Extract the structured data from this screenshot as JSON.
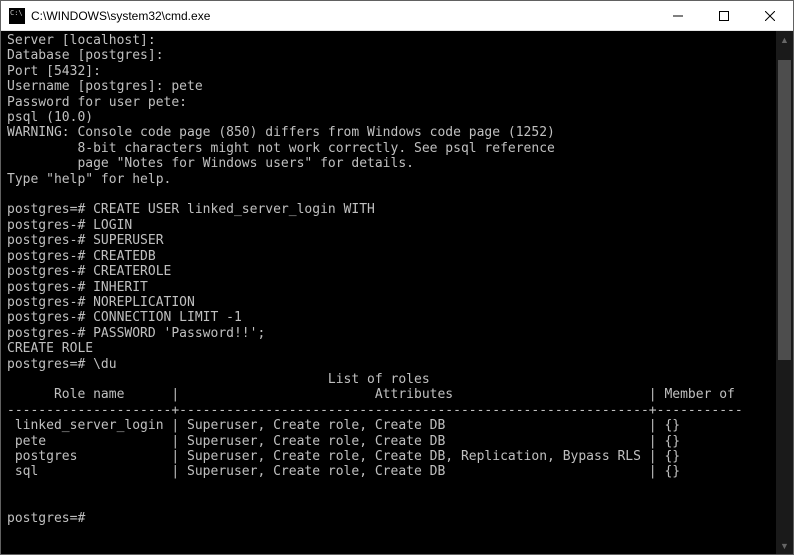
{
  "window": {
    "title": "C:\\WINDOWS\\system32\\cmd.exe"
  },
  "terminal": {
    "lines": [
      "Server [localhost]:",
      "Database [postgres]:",
      "Port [5432]:",
      "Username [postgres]: pete",
      "Password for user pete:",
      "psql (10.0)",
      "WARNING: Console code page (850) differs from Windows code page (1252)",
      "         8-bit characters might not work correctly. See psql reference",
      "         page \"Notes for Windows users\" for details.",
      "Type \"help\" for help.",
      "",
      "postgres=# CREATE USER linked_server_login WITH",
      "postgres-# LOGIN",
      "postgres-# SUPERUSER",
      "postgres-# CREATEDB",
      "postgres-# CREATEROLE",
      "postgres-# INHERIT",
      "postgres-# NOREPLICATION",
      "postgres-# CONNECTION LIMIT -1",
      "postgres-# PASSWORD 'Password!!';",
      "CREATE ROLE",
      "postgres=# \\du",
      "                                         List of roles",
      "      Role name      |                         Attributes                         | Member of",
      "---------------------+------------------------------------------------------------+-----------",
      " linked_server_login | Superuser, Create role, Create DB                          | {}",
      " pete                | Superuser, Create role, Create DB                          | {}",
      " postgres            | Superuser, Create role, Create DB, Replication, Bypass RLS | {}",
      " sql                 | Superuser, Create role, Create DB                          | {}",
      "",
      "",
      "postgres=#"
    ]
  },
  "roles_table": {
    "title": "List of roles",
    "columns": [
      "Role name",
      "Attributes",
      "Member of"
    ],
    "rows": [
      {
        "name": "linked_server_login",
        "attributes": "Superuser, Create role, Create DB",
        "member_of": "{}"
      },
      {
        "name": "pete",
        "attributes": "Superuser, Create role, Create DB",
        "member_of": "{}"
      },
      {
        "name": "postgres",
        "attributes": "Superuser, Create role, Create DB, Replication, Bypass RLS",
        "member_of": "{}"
      },
      {
        "name": "sql",
        "attributes": "Superuser, Create role, Create DB",
        "member_of": "{}"
      }
    ]
  }
}
